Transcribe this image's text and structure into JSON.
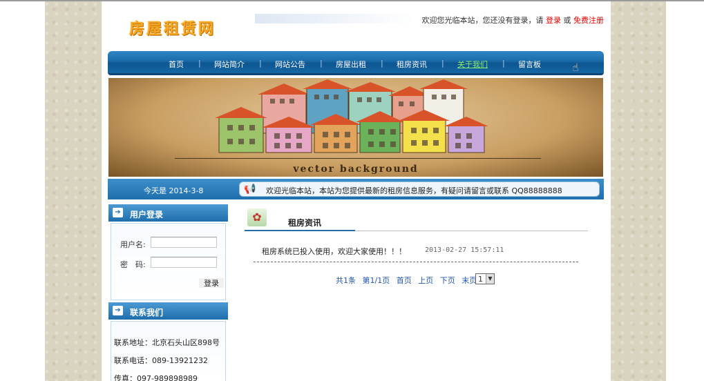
{
  "header": {
    "logo": "房屋租赁网",
    "welcome_prefix": "欢迎您光临本站，您还没有登录，请",
    "login_link": "登录",
    "or_text": "或",
    "register_link": "免费注册"
  },
  "nav": {
    "items": [
      {
        "label": "首页"
      },
      {
        "label": "网站简介"
      },
      {
        "label": "网站公告"
      },
      {
        "label": "房屋出租"
      },
      {
        "label": "租房资讯"
      },
      {
        "label": "关于我们"
      },
      {
        "label": "留言板"
      }
    ],
    "separator": "|"
  },
  "banner": {
    "text": "vector background"
  },
  "datebar": {
    "date": "今天是 2014-3-8",
    "notice": "欢迎光临本站，本站为您提供最新的租房信息服务，有疑问请留言或联系 QQ88888888"
  },
  "login_panel": {
    "title": "用户登录",
    "username_label": "用户名:",
    "password_label": "密　码:",
    "submit": "登录"
  },
  "contact_panel": {
    "title": "联系我们",
    "address": "联系地址：北京石头山区898号",
    "phone": "联系电话：089-13921232",
    "fax": "传真：097-989898989"
  },
  "main": {
    "section_title": "租房资讯",
    "news": [
      {
        "title": "租房系统已投入使用，欢迎大家使用！！！",
        "time": "2013-02-27 15:57:11"
      }
    ],
    "pager": {
      "total": "共1条",
      "page_info": "第1/1页",
      "first": "首页",
      "prev": "上页",
      "next": "下页",
      "last": "末页",
      "selected": "1"
    }
  },
  "colors": {
    "nav_blue": "#1a6aa8",
    "active_nav": "#8cf06a",
    "link_red": "#e00000",
    "page_link": "#2255aa"
  }
}
